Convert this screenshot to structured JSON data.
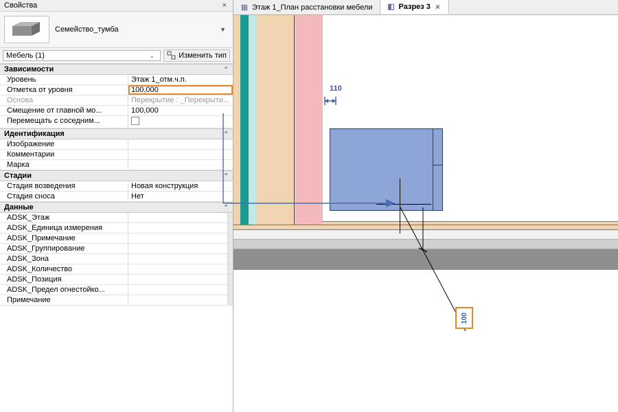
{
  "panel": {
    "title": "Свойства",
    "family_name": "Семейство_тумба",
    "filter": "Мебель (1)",
    "edit_type_label": "Изменить тип"
  },
  "categories": {
    "constraints": "Зависимости",
    "identity": "Идентификация",
    "phasing": "Стадии",
    "data": "Данные"
  },
  "props": {
    "level_l": "Уровень",
    "level_v": "Этаж 1_отм.ч.п.",
    "offset_l": "Отметка от уровня",
    "offset_v": "100,000",
    "host_l": "Основа",
    "host_v": "Перекрытие : _Перекрыти...",
    "hostoff_l": "Смещение от главной мо...",
    "hostoff_v": "100,000",
    "moves_l": "Перемещать с соседним...",
    "image_l": "Изображение",
    "comments_l": "Комментарии",
    "mark_l": "Марка",
    "phase_created_l": "Стадия возведения",
    "phase_created_v": "Новая конструкция",
    "phase_demo_l": "Стадия сноса",
    "phase_demo_v": "Нет",
    "d1": "ADSK_Этаж",
    "d2": "ADSK_Единица измерения",
    "d3": "ADSK_Примечание",
    "d4": "ADSK_Группирование",
    "d5": "ADSK_Зона",
    "d6": "ADSK_Количество",
    "d7": "ADSK_Позиция",
    "d8": "ADSK_Предел огнестойко...",
    "d9": "Примечание"
  },
  "tabs": {
    "plan": "Этаж 1_План расстановки мебели",
    "section": "Разрез 3"
  },
  "dims": {
    "width": "110",
    "offset": "100"
  }
}
